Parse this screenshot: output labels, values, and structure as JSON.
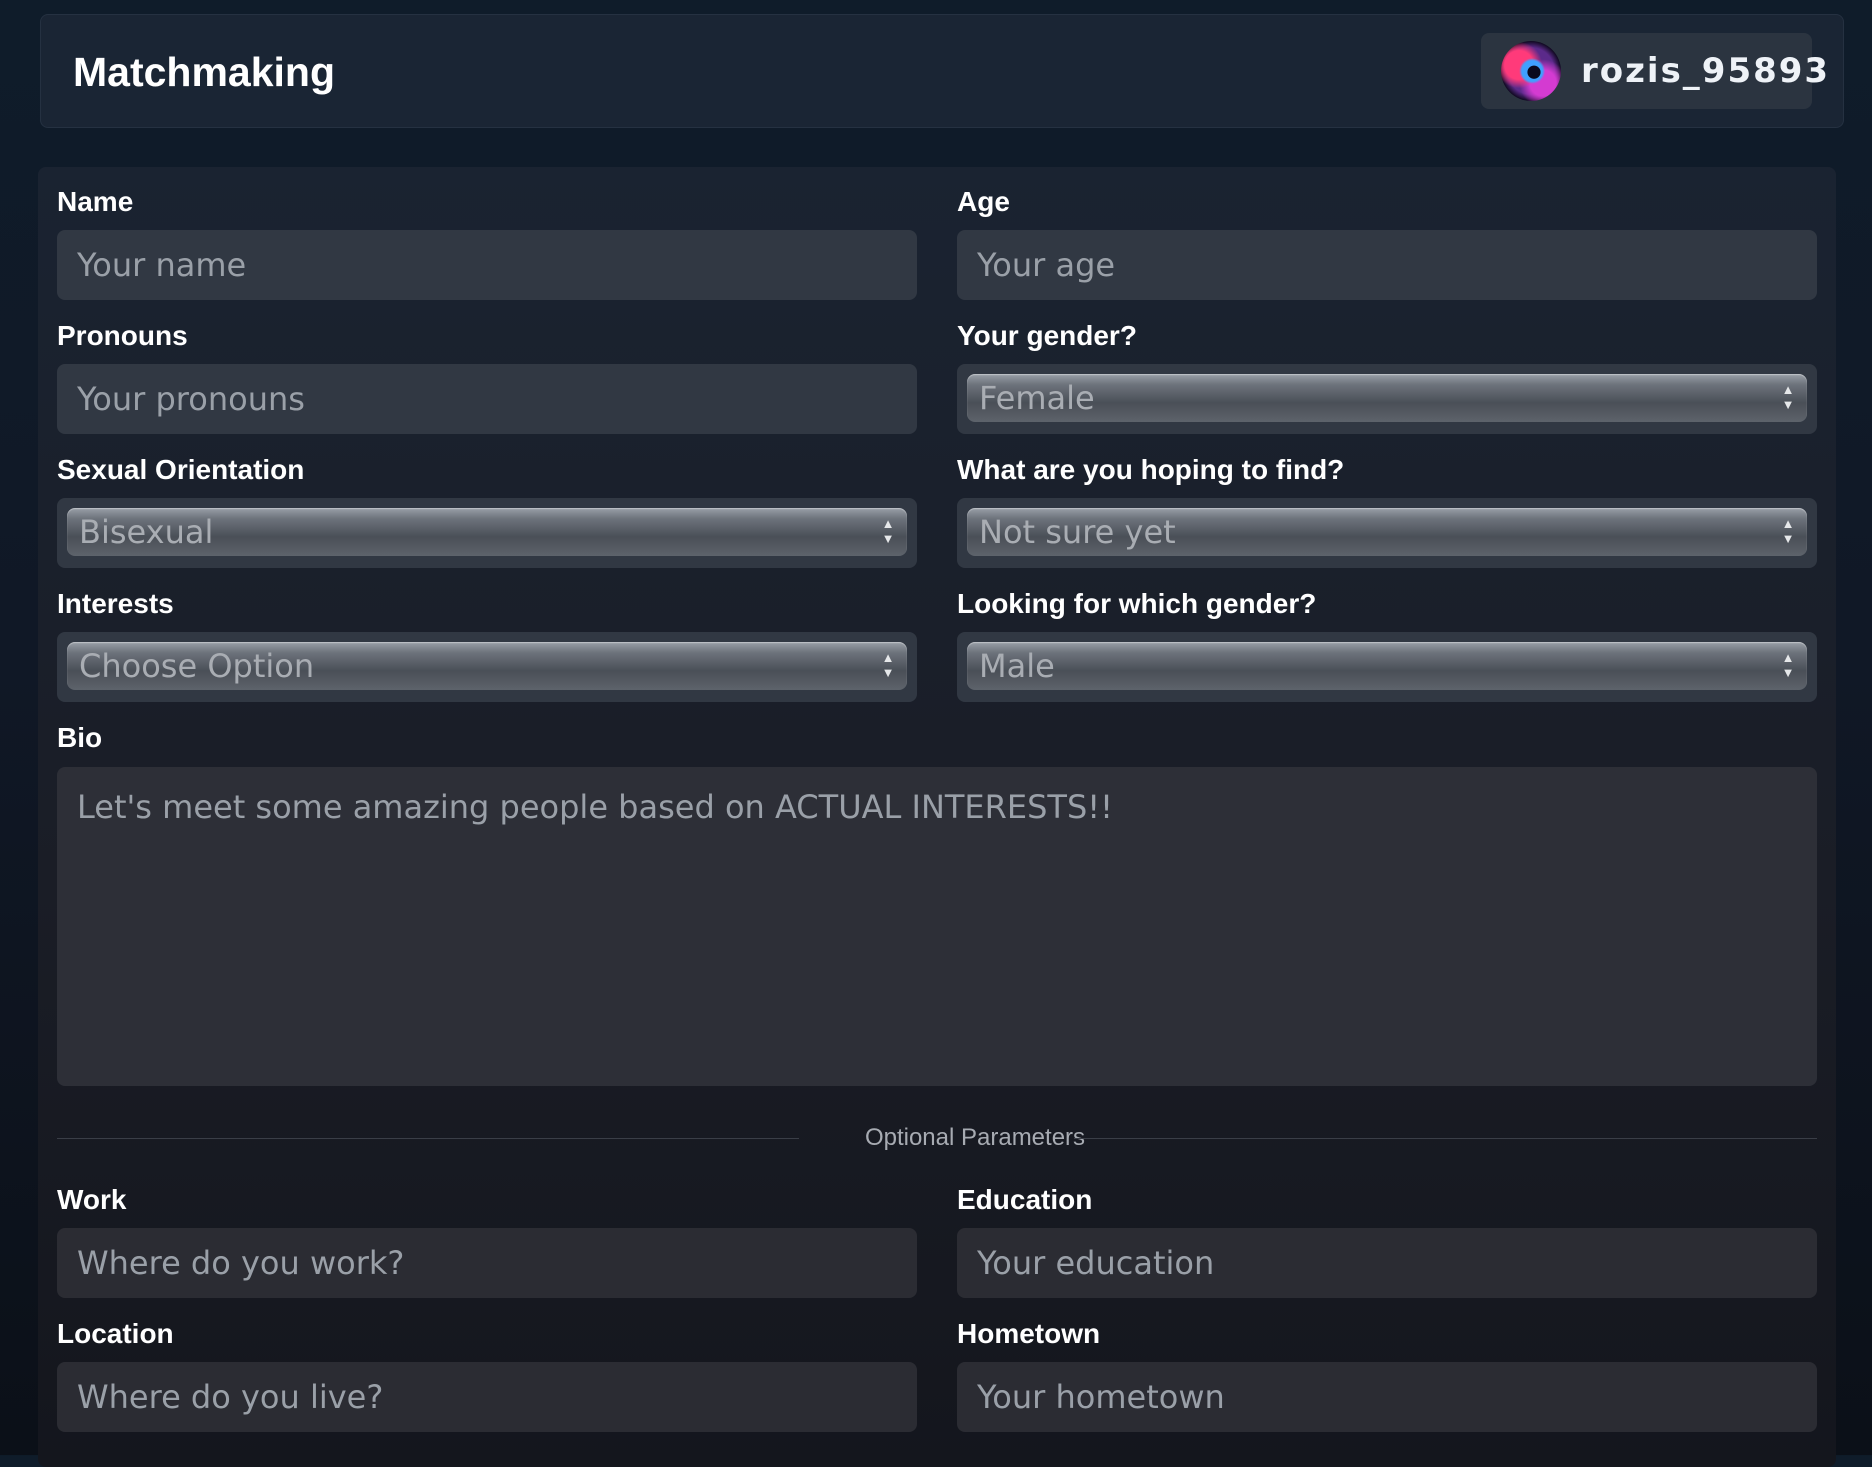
{
  "header": {
    "title": "Matchmaking",
    "username": "rozis_95893"
  },
  "form": {
    "name": {
      "label": "Name",
      "placeholder": "Your name"
    },
    "age": {
      "label": "Age",
      "placeholder": "Your age"
    },
    "pronouns": {
      "label": "Pronouns",
      "placeholder": "Your pronouns"
    },
    "gender": {
      "label": "Your gender?",
      "value": "Female"
    },
    "orientation": {
      "label": "Sexual Orientation",
      "value": "Bisexual"
    },
    "hoping": {
      "label": "What are you hoping to find?",
      "value": "Not sure yet"
    },
    "interests": {
      "label": "Interests",
      "value": "Choose Option"
    },
    "looking_for": {
      "label": "Looking for which gender?",
      "value": "Male"
    },
    "bio": {
      "label": "Bio",
      "placeholder": "Let's meet some amazing people based on ACTUAL INTERESTS!!"
    },
    "optional_divider": "Optional Parameters",
    "work": {
      "label": "Work",
      "placeholder": "Where do you work?"
    },
    "education": {
      "label": "Education",
      "placeholder": "Your education"
    },
    "location": {
      "label": "Location",
      "placeholder": "Where do you live?"
    },
    "hometown": {
      "label": "Hometown",
      "placeholder": "Your hometown"
    }
  },
  "icons": {
    "avatar": "galaxy-avatar",
    "select_arrows": "updown-arrows-icon"
  }
}
